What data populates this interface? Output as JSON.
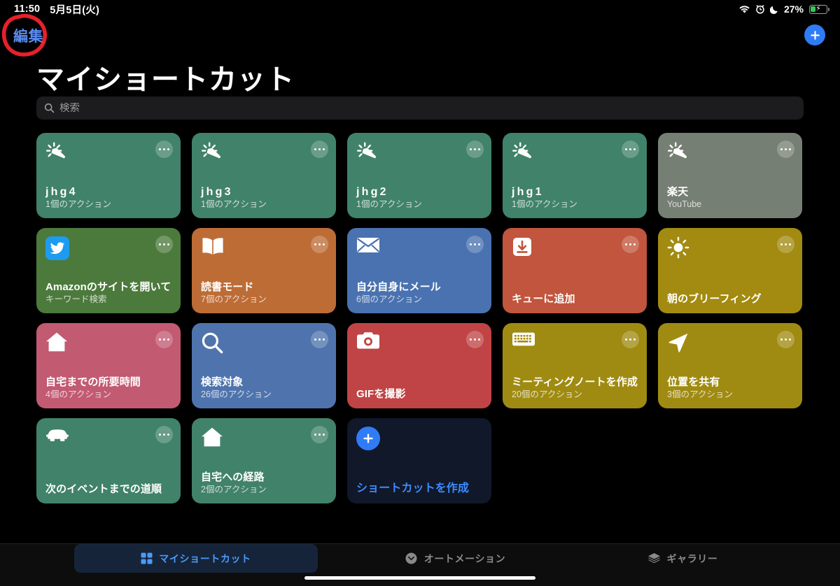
{
  "status_bar": {
    "time": "11:50",
    "date": "5月5日(火)",
    "battery_percent": "27%",
    "icons": [
      "wifi-icon",
      "alarm-icon",
      "do-not-disturb-moon-icon",
      "battery-charging-icon"
    ],
    "battery_level_fraction": 0.27,
    "battery_color": "#34c759"
  },
  "nav": {
    "edit_label": "編集",
    "edit_color": "#5a8cf0",
    "add_label": "+",
    "add_color": "#2f7cf6",
    "annotation_color": "#e8202a"
  },
  "header": {
    "title": "マイショートカット"
  },
  "search": {
    "placeholder": "検索",
    "value": "",
    "icon": "search-icon"
  },
  "shortcuts": [
    {
      "title": "jhg4",
      "subtitle": "1個のアクション",
      "icon": "magic-wand-icon",
      "color": "#41826a",
      "spaced_title": true
    },
    {
      "title": "jhg3",
      "subtitle": "1個のアクション",
      "icon": "magic-wand-icon",
      "color": "#41826a",
      "spaced_title": true
    },
    {
      "title": "jhg2",
      "subtitle": "1個のアクション",
      "icon": "magic-wand-icon",
      "color": "#41826a",
      "spaced_title": true
    },
    {
      "title": "jhg1",
      "subtitle": "1個のアクション",
      "icon": "magic-wand-icon",
      "color": "#41826a",
      "spaced_title": true
    },
    {
      "title": "楽天",
      "subtitle": "YouTube",
      "icon": "magic-wand-icon",
      "color": "#767f73",
      "spaced_title": false
    },
    {
      "title": "Amazonのサイトを開いて",
      "subtitle": "キーワード検索",
      "icon": "twitter-icon",
      "color": "#4c7a3c",
      "spaced_title": false
    },
    {
      "title": "読書モード",
      "subtitle": "7個のアクション",
      "icon": "book-icon",
      "color": "#bd6c36",
      "spaced_title": false
    },
    {
      "title": "自分自身にメール",
      "subtitle": "6個のアクション",
      "icon": "envelope-icon",
      "color": "#4a72b0",
      "spaced_title": false
    },
    {
      "title": "キューに追加",
      "subtitle": "",
      "icon": "download-tray-icon",
      "color": "#c1553d",
      "spaced_title": false
    },
    {
      "title": "朝のブリーフィング",
      "subtitle": "",
      "icon": "sun-icon",
      "color": "#a28b10",
      "spaced_title": false
    },
    {
      "title": "自宅までの所要時間",
      "subtitle": "4個のアクション",
      "icon": "home-icon",
      "color": "#c25a72",
      "spaced_title": false
    },
    {
      "title": "検索対象",
      "subtitle": "26個のアクション",
      "icon": "search-icon",
      "color": "#4f74ad",
      "spaced_title": false
    },
    {
      "title": "GIFを撮影",
      "subtitle": "",
      "icon": "camera-icon",
      "color": "#c04445",
      "spaced_title": false
    },
    {
      "title": "ミーティングノートを作成",
      "subtitle": "20個のアクション",
      "icon": "keyboard-icon",
      "color": "#a08b12",
      "spaced_title": false
    },
    {
      "title": "位置を共有",
      "subtitle": "3個のアクション",
      "icon": "location-arrow-icon",
      "color": "#a08b12",
      "spaced_title": false
    },
    {
      "title": "次のイベントまでの道順",
      "subtitle": "",
      "icon": "car-icon",
      "color": "#41826a",
      "spaced_title": false
    },
    {
      "title": "自宅への経路",
      "subtitle": "2個のアクション",
      "icon": "home-icon",
      "color": "#41826a",
      "spaced_title": false
    }
  ],
  "create_card": {
    "title": "ショートカットを作成",
    "icon": "plus-icon",
    "color": "#10182a",
    "accent": "#2f7cf6"
  },
  "tabs": [
    {
      "label": "マイショートカット",
      "icon": "grid-squares-icon",
      "active": true
    },
    {
      "label": "オートメーション",
      "icon": "automation-clock-icon",
      "active": false
    },
    {
      "label": "ギャラリー",
      "icon": "layers-icon",
      "active": false
    }
  ],
  "card_menu": {
    "label": "...",
    "icon": "ellipsis-icon"
  }
}
